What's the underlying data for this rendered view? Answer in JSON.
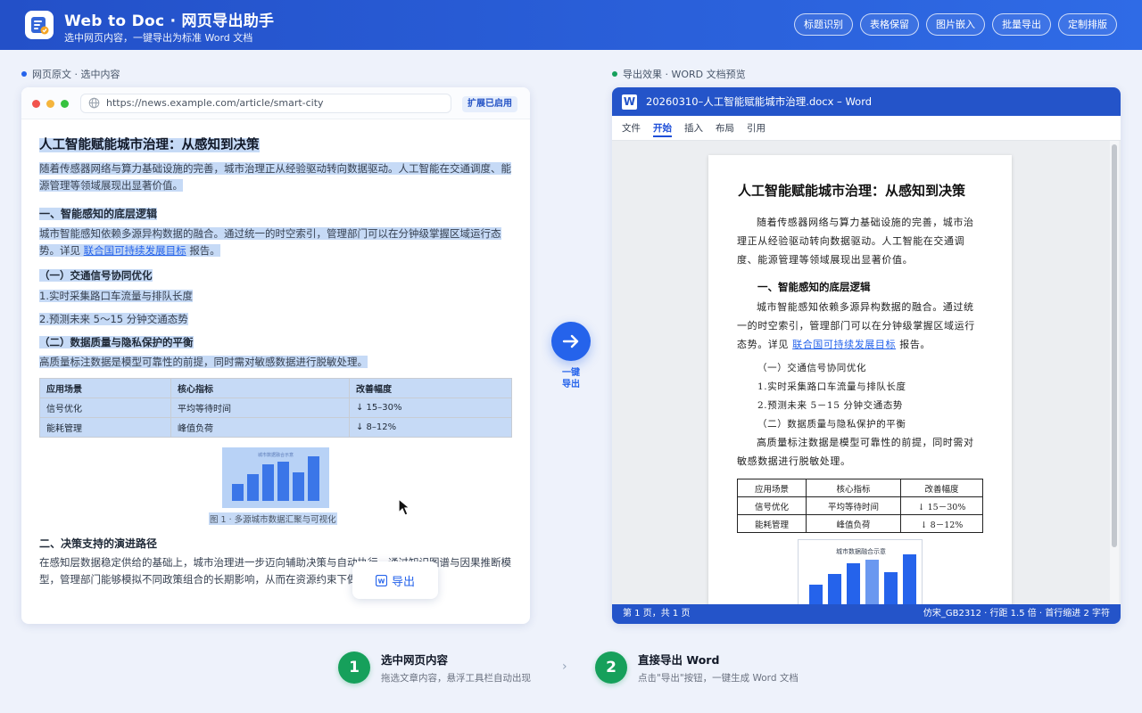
{
  "header": {
    "title": "Web to Doc · 网页导出助手",
    "subtitle": "选中网页内容，一键导出为标准 Word 文档",
    "actions": [
      "标题识别",
      "表格保留",
      "图片嵌入",
      "批量导出",
      "定制排版"
    ]
  },
  "left_section": {
    "label": "网页原文 · 选中内容",
    "dot_color": "#2563eb"
  },
  "right_section": {
    "label": "导出效果 · WORD 文档预览",
    "dot_color": "#16a05b"
  },
  "browser": {
    "url": "https://news.example.com/article/smart-city",
    "extension_badge": "扩展已启用",
    "article": {
      "title": "人工智能赋能城市治理：从感知到决策",
      "intro_l1": "随着传感器网络与算力基础设施的完善，城市治理正从经验驱动转向数据驱动。人工智能在交通调度、能",
      "intro_l2": "源管理等领域展现出显著价值。",
      "h2_1": "一、智能感知的底层逻辑",
      "p2_l1": "城市智能感知依赖多源异构数据的融合。通过统一的时空索引，管理部门可以在分钟级掌握区域运行态",
      "p2_l2a": "势。详见",
      "link": "联合国可持续发展目标",
      "p2_l2b": "报告。",
      "h3_1": "（一）交通信号协同优化",
      "li1": "1.实时采集路口车流量与排队长度",
      "li2": "2.预测未来 5～15 分钟交通态势",
      "h3_2": "（二）数据质量与隐私保护的平衡",
      "p3": "高质量标注数据是模型可靠性的前提，同时需对敏感数据进行脱敏处理。",
      "table": {
        "headers": [
          "应用场景",
          "核心指标",
          "改善幅度"
        ],
        "rows": [
          [
            "信号优化",
            "平均等待时间",
            "↓ 15–30%"
          ],
          [
            "能耗管理",
            "峰值负荷",
            "↓ 8–12%"
          ]
        ]
      },
      "figure_title": "城市数据融合示意",
      "figure_caption": "图 1 · 多源城市数据汇聚与可视化",
      "h2_2": "二、决策支持的演进路径",
      "p4_l1": "在感知层数据稳定供给的基础上，城市治理进一步迈向辅助决策与自动执行。通过知识图谱与因果推断模",
      "p4_l2": "型，管理部门能够模拟不同政策组合的长期影响，从而在资源约束下做出更优选择。"
    },
    "floating_export": "导出"
  },
  "middle": {
    "label_l1": "一键",
    "label_l2": "导出"
  },
  "word": {
    "window_title": "20260310–人工智能赋能城市治理.docx – Word",
    "ribbon": [
      "文件",
      "开始",
      "插入",
      "布局",
      "引用"
    ],
    "ribbon_active": "开始",
    "doc": {
      "title": "人工智能赋能城市治理：从感知到决策",
      "p1_l1": "随着传感器网络与算力基础设施的完善，城市治",
      "p1_l2": "理正从经验驱动转向数据驱动。人工智能在交通调",
      "p1_l3": "度、能源管理等领域展现出显著价值。",
      "h2": "一、智能感知的底层逻辑",
      "p2_l1": "城市智能感知依赖多源异构数据的融合。通过统",
      "p2_l2": "一的时空索引，管理部门可以在分钟级掌握区域运行",
      "p2_l3a": "态势。详见",
      "link": "联合国可持续发展目标",
      "p2_l3b": "报告。",
      "h3_1": "（一）交通信号协同优化",
      "li1": "1.实时采集路口车流量与排队长度",
      "li2": "2.预测未来 5－15 分钟交通态势",
      "h3_2": "（二）数据质量与隐私保护的平衡",
      "p3_l1": "高质量标注数据是模型可靠性的前提，同时需对",
      "p3_l2": "敏感数据进行脱敏处理。",
      "table": {
        "headers": [
          "应用场景",
          "核心指标",
          "改善幅度"
        ],
        "rows": [
          [
            "信号优化",
            "平均等待时间",
            "↓ 15－30%"
          ],
          [
            "能耗管理",
            "峰值负荷",
            "↓ 8－12%"
          ]
        ]
      },
      "figure_title": "城市数据融合示意"
    },
    "status_left": "第 1 页，共 1 页",
    "status_right": "仿宋_GB2312 · 行距 1.5 倍 · 首行缩进 2 字符"
  },
  "steps": [
    {
      "num": "1",
      "title": "选中网页内容",
      "desc": "拖选文章内容，悬浮工具栏自动出现"
    },
    {
      "num": "2",
      "title": "直接导出 Word",
      "desc": "点击\"导出\"按钮，一键生成 Word 文档"
    }
  ],
  "colors": {
    "brand": "#2454c9",
    "accent": "#2563eb",
    "success": "#16a05b",
    "selection": "#c6daf6"
  }
}
